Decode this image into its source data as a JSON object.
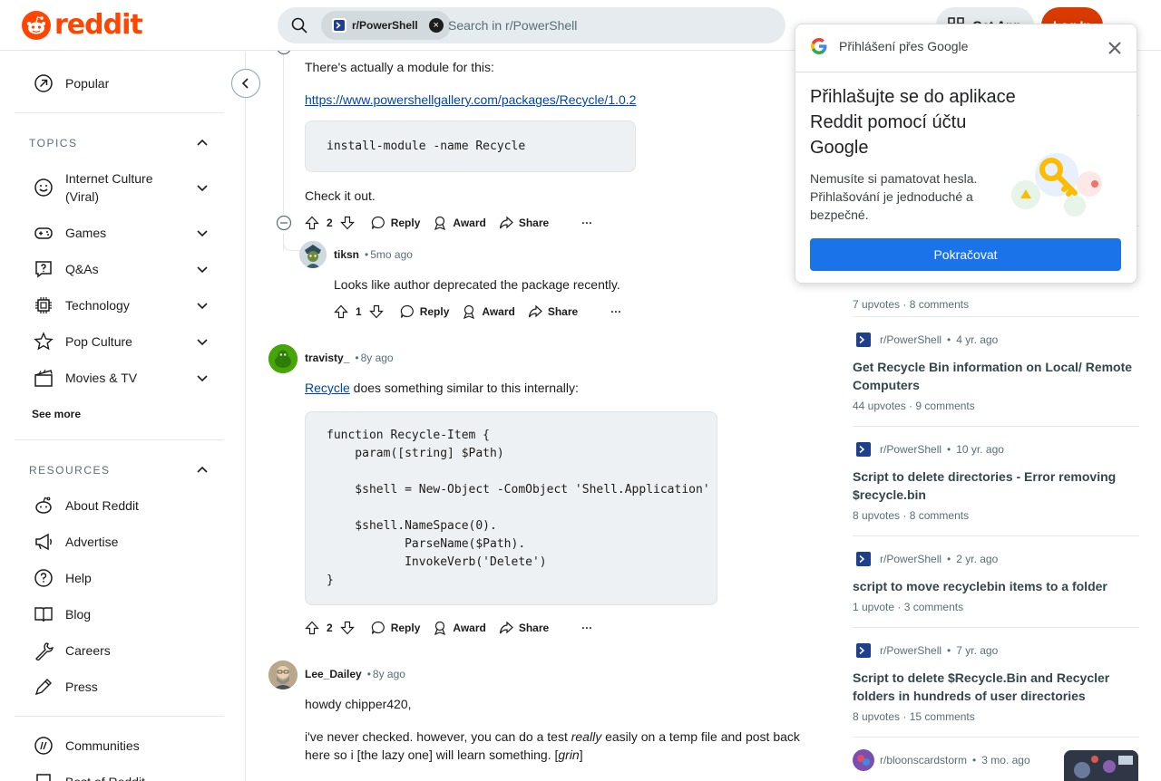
{
  "header": {
    "logo_text": "reddit",
    "search_chip": "r/PowerShell",
    "search_placeholder": "Search in r/PowerShell",
    "get_app_label": "Get App",
    "login_label": "Log In"
  },
  "sidebar": {
    "popular_label": "Popular",
    "topics_heading": "TOPICS",
    "topics": [
      {
        "label": "Internet Culture (Viral)",
        "icon": "smile-icon"
      },
      {
        "label": "Games",
        "icon": "gamepad-icon"
      },
      {
        "label": "Q&As",
        "icon": "question-icon"
      },
      {
        "label": "Technology",
        "icon": "chip-icon"
      },
      {
        "label": "Pop Culture",
        "icon": "star-icon"
      },
      {
        "label": "Movies & TV",
        "icon": "clapperboard-icon"
      }
    ],
    "see_more_label": "See more",
    "resources_heading": "RESOURCES",
    "resources": [
      {
        "label": "About Reddit",
        "icon": "reddit-icon"
      },
      {
        "label": "Advertise",
        "icon": "megaphone-icon"
      },
      {
        "label": "Help",
        "icon": "help-icon"
      },
      {
        "label": "Blog",
        "icon": "book-icon"
      },
      {
        "label": "Careers",
        "icon": "wrench-icon"
      },
      {
        "label": "Press",
        "icon": "pen-icon"
      }
    ],
    "communities_label": "Communities",
    "best_of_label": "Best of Reddit"
  },
  "comments": {
    "c1": {
      "text_intro": "There's actually a module for this:",
      "link": "https://www.powershellgallery.com/packages/Recycle/1.0.2",
      "code": [
        "install-module -name Recycle"
      ],
      "text_outro": "Check it out.",
      "votes": "2"
    },
    "c2": {
      "author": "tiksn",
      "time": "5mo ago",
      "text": "Looks like author deprecated the package recently.",
      "votes": "1"
    },
    "c3": {
      "author": "travisty_",
      "time": "8y ago",
      "link": "Recycle",
      "text": " does something similar to this internally:",
      "code": [
        "function Recycle-Item {",
        "    param([string] $Path)",
        "",
        "    $shell = New-Object -ComObject 'Shell.Application'",
        "",
        "    $shell.NameSpace(0).",
        "           ParseName($Path).",
        "           InvokeVerb('Delete')",
        "}"
      ],
      "votes": "2"
    },
    "c4": {
      "author": "Lee_Dailey",
      "time": "8y ago",
      "text1": "howdy chipper420,",
      "text2_a": "i've never checked. however, you can do a test ",
      "text2_em": "really",
      "text2_b": " easily on a temp file and post back here so i [the lazy one] will learn something. [",
      "text2_em2": "grin",
      "text2_c": "]"
    },
    "actions": {
      "reply": "Reply",
      "award": "Award",
      "share": "Share",
      "more": "···"
    }
  },
  "related": {
    "partial_stats": {
      "upvotes": "7 upvotes",
      "comments": "8 comments"
    },
    "posts": [
      {
        "sub": "r/PowerShell",
        "time": "4 yr. ago",
        "title": "Get Recycle Bin information on Local/ Remote Computers",
        "upvotes": "44 upvotes",
        "comments": "9 comments"
      },
      {
        "sub": "r/PowerShell",
        "time": "10 yr. ago",
        "title": "Script to delete directories - Error removing $recycle.bin",
        "upvotes": "8 upvotes",
        "comments": "8 comments"
      },
      {
        "sub": "r/PowerShell",
        "time": "2 yr. ago",
        "title": "script to move recyclebin items to a folder",
        "upvotes": "1 upvote",
        "comments": "3 comments"
      },
      {
        "sub": "r/PowerShell",
        "time": "7 yr. ago",
        "title": "Script to delete $Recycle.Bin and Recycler folders in hundreds of user directories",
        "upvotes": "8 upvotes",
        "comments": "15 comments"
      },
      {
        "sub": "r/bloonscardstorm",
        "time": "3 mo. ago"
      }
    ]
  },
  "google_popup": {
    "header": "Přihlášení přes Google",
    "title": "Přihlašujte se do aplikace Reddit pomocí účtu Google",
    "description": "Nemusíte si pamatovat hesla. Přihlašování je jednoduché a bezpečné.",
    "button": "Pokračovat"
  },
  "colors": {
    "brand": "#ff4500",
    "login": "#d93a00",
    "link": "#0045ac",
    "google_blue": "#1a73e8"
  }
}
